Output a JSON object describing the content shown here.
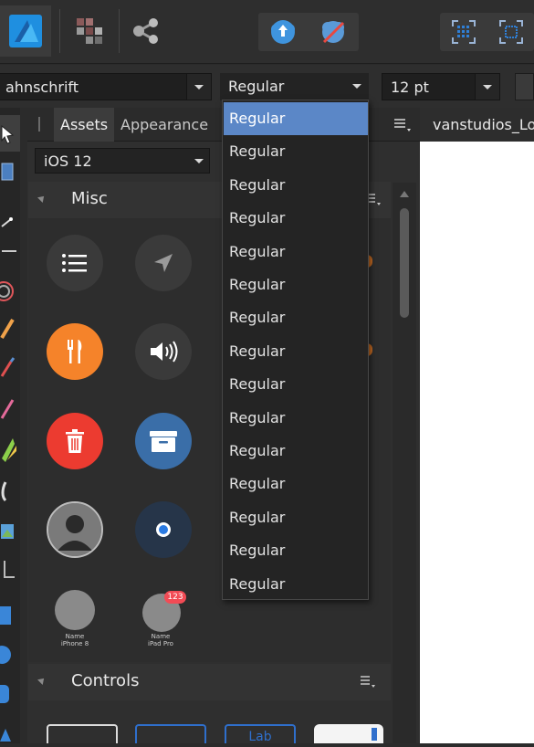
{
  "font_family_combo": {
    "value": "ahnschrift"
  },
  "font_style_combo": {
    "value": "Regular"
  },
  "font_size_combo": {
    "value": "12 pt"
  },
  "panel_tabs": [
    {
      "label": "Assets",
      "active": true
    },
    {
      "label": "Appearance",
      "active": false
    }
  ],
  "asset_category_select": {
    "value": "iOS 12"
  },
  "sections": {
    "misc": "Misc",
    "controls": "Controls"
  },
  "misc_assets": {
    "badge": "123",
    "name_left": "Name",
    "device_left": "iPhone 8",
    "name_right": "Name",
    "device_right": "iPad Pro"
  },
  "controls_preview": {
    "label_partial": "Lab"
  },
  "document_tab": {
    "title": "vanstudios_Lo"
  },
  "dropdown_items": [
    "Regular",
    "Regular",
    "Regular",
    "Regular",
    "Regular",
    "Regular",
    "Regular",
    "Regular",
    "Regular",
    "Regular",
    "Regular",
    "Regular",
    "Regular",
    "Regular",
    "Regular"
  ],
  "colors": {
    "selection_blue": "#5b87c7",
    "orange": "#f5832a",
    "red": "#ec3b30",
    "blue_button": "#3a6ea8",
    "dark_circle": "#3a3a3a"
  }
}
